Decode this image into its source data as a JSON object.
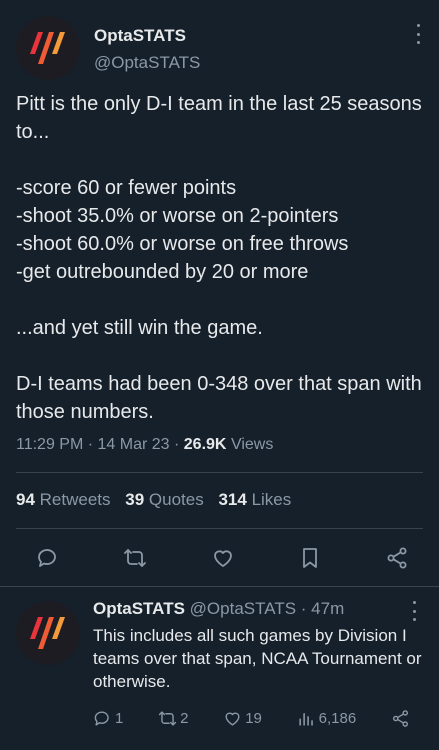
{
  "tweet": {
    "author_name": "OptaSTATS",
    "author_handle": "@OptaSTATS",
    "body": "Pitt is the only D-I team in the last 25 seasons to...\n\n-score 60 or fewer points\n-shoot 35.0% or worse on 2-pointers\n-shoot 60.0% or worse on free throws\n-get outrebounded by 20 or more\n\n...and yet still win the game.\n\nD-I teams had been 0-348 over that span with those numbers.",
    "time": "11:29 PM",
    "date": "14 Mar 23",
    "views_count": "26.9K",
    "views_label": "Views",
    "separator": " · "
  },
  "stats": {
    "retweets_count": "94",
    "retweets_label": "Retweets",
    "quotes_count": "39",
    "quotes_label": "Quotes",
    "likes_count": "314",
    "likes_label": "Likes"
  },
  "actions": {
    "icons": [
      "reply-icon",
      "retweet-icon",
      "like-icon",
      "bookmark-icon",
      "share-icon"
    ]
  },
  "reply": {
    "author_name": "OptaSTATS",
    "author_handle": "@OptaSTATS",
    "age": "47m",
    "separator": " · ",
    "text": "This includes all such games by Division I teams over that span, NCAA Tournament or otherwise.",
    "reply_count": "1",
    "retweet_count": "2",
    "like_count": "19",
    "view_count": "6,186"
  },
  "colors": {
    "background": "#15202b",
    "text_primary": "#e7e9ea",
    "text_secondary": "#8b98a5",
    "divider": "#38444d",
    "logo_red": "#e8343a",
    "logo_orange": "#f39a3a"
  }
}
